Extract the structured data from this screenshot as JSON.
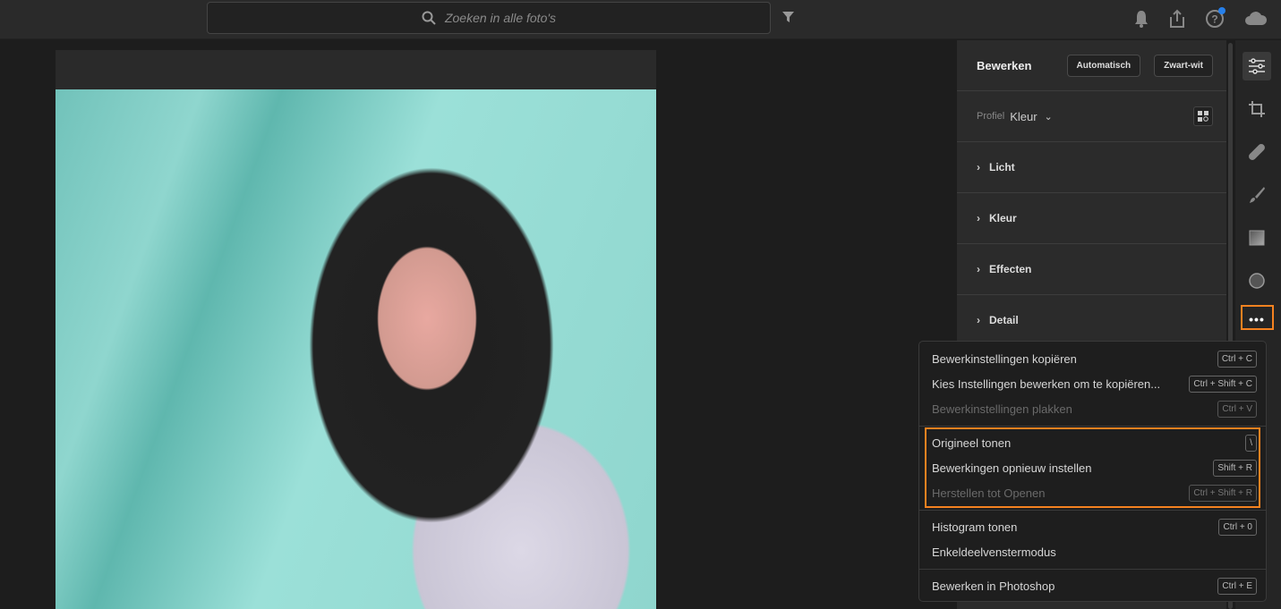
{
  "search": {
    "placeholder": "Zoeken in alle foto's"
  },
  "top_icons": [
    "filter-icon",
    "bell-icon",
    "share-icon",
    "help-icon",
    "cloud-icon"
  ],
  "panel": {
    "title": "Bewerken",
    "auto_label": "Automatisch",
    "bw_label": "Zwart-wit",
    "profile_label": "Profiel",
    "profile_value": "Kleur",
    "sections": [
      "Licht",
      "Kleur",
      "Effecten",
      "Detail"
    ]
  },
  "tools": [
    "sliders-icon",
    "crop-icon",
    "healing-icon",
    "brush-icon",
    "gradient-icon",
    "radial-icon",
    "more-icon"
  ],
  "menu": {
    "items": [
      {
        "label": "Bewerkinstellingen kopiëren",
        "shortcut": "Ctrl + C"
      },
      {
        "label": "Kies Instellingen bewerken om te kopiëren...",
        "shortcut": "Ctrl + Shift + C"
      },
      {
        "label": "Bewerkinstellingen plakken",
        "shortcut": "Ctrl + V",
        "disabled": true
      },
      {
        "label": "Origineel tonen",
        "shortcut": "\\"
      },
      {
        "label": "Bewerkingen opnieuw instellen",
        "shortcut": "Shift + R"
      },
      {
        "label": "Herstellen tot Openen",
        "shortcut": "Ctrl + Shift + R",
        "disabled": true
      },
      {
        "label": "Histogram tonen",
        "shortcut": "Ctrl + 0"
      },
      {
        "label": "Enkeldeelvenstermodus"
      },
      {
        "label": "Bewerken in Photoshop",
        "shortcut": "Ctrl + E"
      }
    ]
  },
  "colors": {
    "accent": "#f58220",
    "notify": "#2680eb"
  }
}
